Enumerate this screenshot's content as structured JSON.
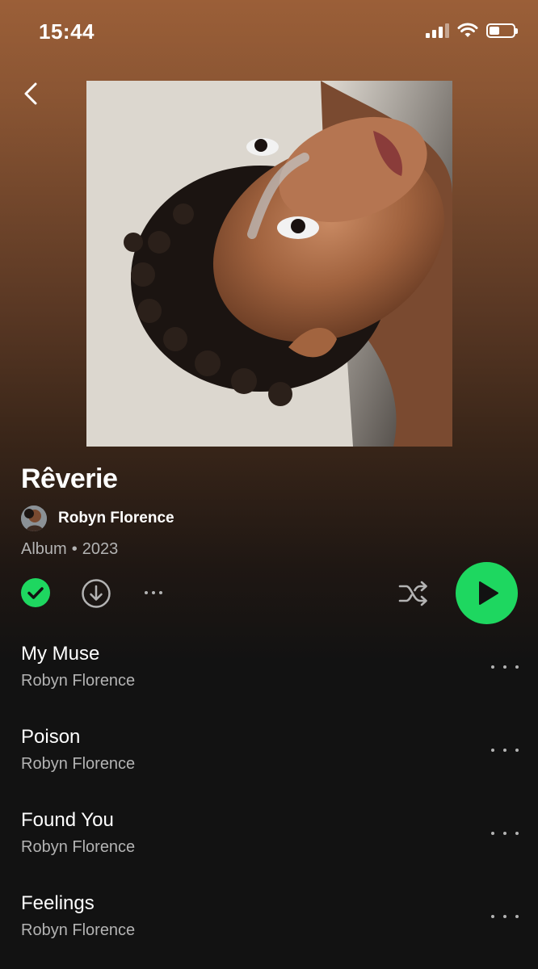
{
  "status_bar": {
    "time": "15:44"
  },
  "album": {
    "title": "Rêverie",
    "artist": "Robyn Florence",
    "type": "Album",
    "separator": "•",
    "year": "2023",
    "liked": true
  },
  "colors": {
    "accent": "#1ed760",
    "background": "#121212",
    "header_gradient_top": "#9b5f38",
    "secondary_text": "#b3b3b3"
  },
  "controls": {
    "icons": [
      "back-icon",
      "check-icon",
      "download-icon",
      "more-icon",
      "shuffle-icon",
      "play-icon"
    ]
  },
  "tracks": [
    {
      "title": "My Muse",
      "artist": "Robyn Florence"
    },
    {
      "title": "Poison",
      "artist": "Robyn Florence"
    },
    {
      "title": "Found You",
      "artist": "Robyn Florence"
    },
    {
      "title": "Feelings",
      "artist": "Robyn Florence"
    }
  ]
}
